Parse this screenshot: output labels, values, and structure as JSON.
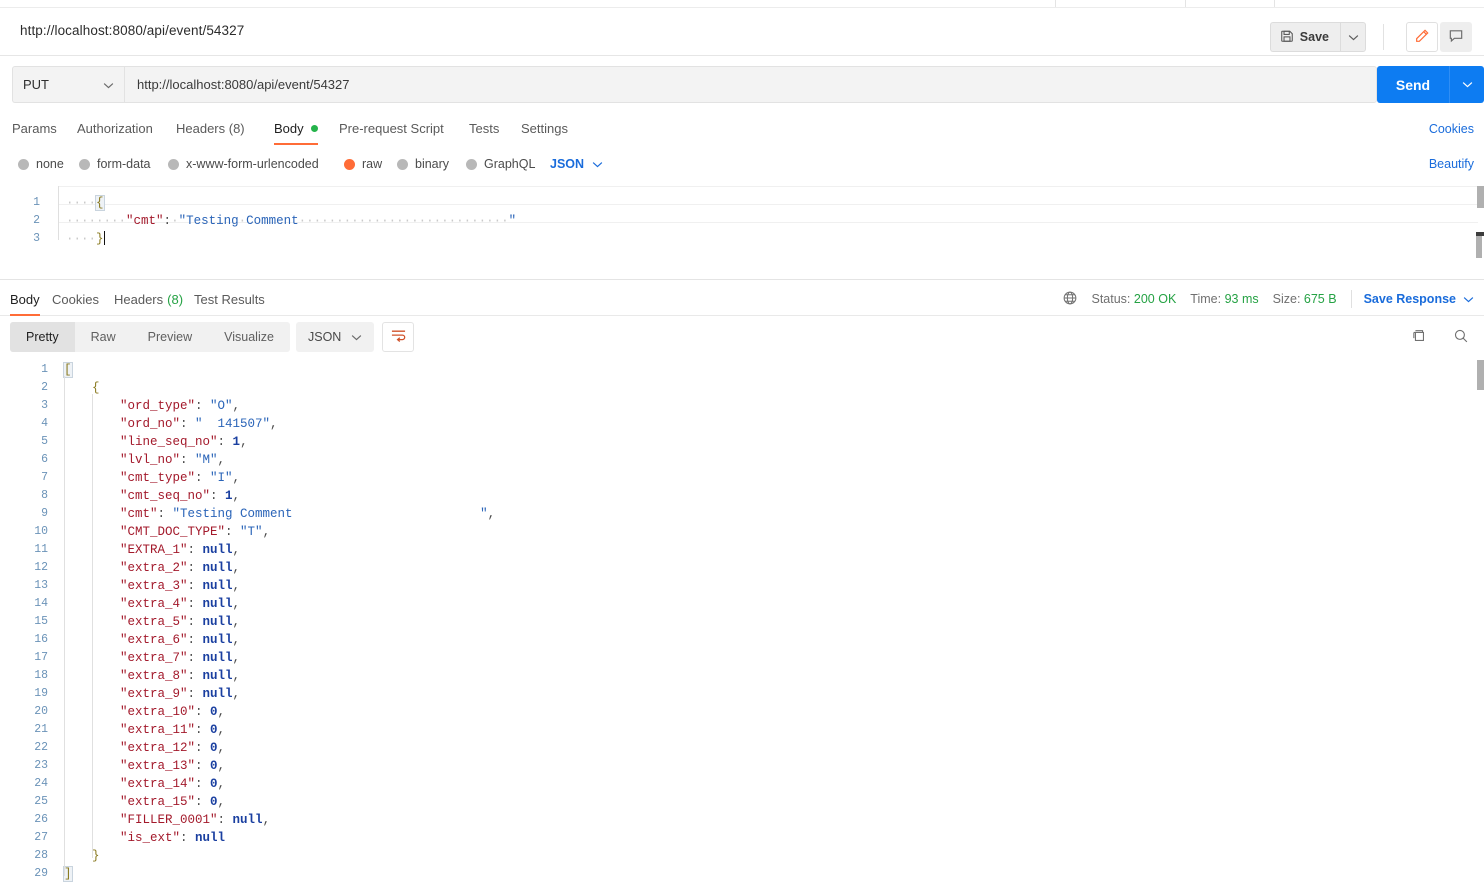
{
  "window": {
    "request_name": "http://localhost:8080/api/event/54327"
  },
  "toolbar": {
    "save_label": "Save",
    "save_icon": "floppy-disk-icon",
    "save_caret_icon": "chevron-down-icon",
    "edit_icon": "pencil-icon",
    "comment_icon": "comment-icon"
  },
  "url_bar": {
    "method": "PUT",
    "method_caret_icon": "chevron-down-icon",
    "url": "http://localhost:8080/api/event/54327",
    "send_label": "Send",
    "send_caret_icon": "chevron-down-icon"
  },
  "request_tabs": {
    "items": [
      {
        "label": "Params",
        "active": false
      },
      {
        "label": "Authorization",
        "active": false
      },
      {
        "label": "Headers (8)",
        "active": false
      },
      {
        "label": "Body",
        "active": true,
        "dot": true
      },
      {
        "label": "Pre-request Script",
        "active": false
      },
      {
        "label": "Tests",
        "active": false
      },
      {
        "label": "Settings",
        "active": false
      }
    ],
    "cookies_link": "Cookies"
  },
  "body_types": {
    "options": [
      {
        "label": "none",
        "selected": false
      },
      {
        "label": "form-data",
        "selected": false
      },
      {
        "label": "x-www-form-urlencoded",
        "selected": false
      },
      {
        "label": "raw",
        "selected": true
      },
      {
        "label": "binary",
        "selected": false
      },
      {
        "label": "GraphQL",
        "selected": false
      }
    ],
    "format": "JSON",
    "format_caret_icon": "chevron-down-icon",
    "beautify_link": "Beautify"
  },
  "request_body": {
    "line_numbers": [
      "1",
      "2",
      "3"
    ],
    "lines": [
      {
        "n": 1,
        "indent_dots": 4,
        "text": "{"
      },
      {
        "n": 2,
        "indent_dots": 4,
        "text": "    \"cmt\": \"Testing Comment",
        "pad_dots": 28,
        "tail": "\""
      },
      {
        "n": 3,
        "indent_dots": 4,
        "text": "}"
      }
    ],
    "raw": "{\n    \"cmt\": \"Testing Comment                            \"\n}"
  },
  "response_tabs": {
    "items": [
      {
        "label": "Body",
        "active": true
      },
      {
        "label": "Cookies",
        "active": false
      },
      {
        "label": "Headers",
        "count": "(8)",
        "active": false
      },
      {
        "label": "Test Results",
        "active": false
      }
    ]
  },
  "response_status": {
    "globe_icon": "globe-icon",
    "status_label": "Status:",
    "status_value": "200 OK",
    "time_label": "Time:",
    "time_value": "93 ms",
    "size_label": "Size:",
    "size_value": "675 B",
    "save_response_label": "Save Response",
    "save_response_caret_icon": "chevron-down-icon"
  },
  "response_view": {
    "modes": [
      {
        "label": "Pretty",
        "active": true
      },
      {
        "label": "Raw",
        "active": false
      },
      {
        "label": "Preview",
        "active": false
      },
      {
        "label": "Visualize",
        "active": false
      }
    ],
    "format": "JSON",
    "format_caret_icon": "chevron-down-icon",
    "wrap_icon": "word-wrap-icon",
    "copy_icon": "copy-icon",
    "search_icon": "search-icon"
  },
  "response_body": {
    "line_count": 29,
    "lines": [
      {
        "n": 1,
        "indent": 0,
        "kind": "bracket",
        "text": "["
      },
      {
        "n": 2,
        "indent": 1,
        "kind": "brace",
        "text": "{"
      },
      {
        "n": 3,
        "indent": 2,
        "kind": "pair",
        "key": "ord_type",
        "value": "O",
        "vtype": "string",
        "comma": true
      },
      {
        "n": 4,
        "indent": 2,
        "kind": "pair",
        "key": "ord_no",
        "value": "  141507",
        "vtype": "string",
        "comma": true
      },
      {
        "n": 5,
        "indent": 2,
        "kind": "pair",
        "key": "line_seq_no",
        "value": "1",
        "vtype": "number",
        "comma": true
      },
      {
        "n": 6,
        "indent": 2,
        "kind": "pair",
        "key": "lvl_no",
        "value": "M",
        "vtype": "string",
        "comma": true
      },
      {
        "n": 7,
        "indent": 2,
        "kind": "pair",
        "key": "cmt_type",
        "value": "I",
        "vtype": "string",
        "comma": true
      },
      {
        "n": 8,
        "indent": 2,
        "kind": "pair",
        "key": "cmt_seq_no",
        "value": "1",
        "vtype": "number",
        "comma": true
      },
      {
        "n": 9,
        "indent": 2,
        "kind": "pair",
        "key": "cmt",
        "value": "Testing Comment                         ",
        "vtype": "string",
        "comma": true
      },
      {
        "n": 10,
        "indent": 2,
        "kind": "pair",
        "key": "CMT_DOC_TYPE",
        "value": "T",
        "vtype": "string",
        "comma": true
      },
      {
        "n": 11,
        "indent": 2,
        "kind": "pair",
        "key": "EXTRA_1",
        "value": "null",
        "vtype": "null",
        "comma": true
      },
      {
        "n": 12,
        "indent": 2,
        "kind": "pair",
        "key": "extra_2",
        "value": "null",
        "vtype": "null",
        "comma": true
      },
      {
        "n": 13,
        "indent": 2,
        "kind": "pair",
        "key": "extra_3",
        "value": "null",
        "vtype": "null",
        "comma": true
      },
      {
        "n": 14,
        "indent": 2,
        "kind": "pair",
        "key": "extra_4",
        "value": "null",
        "vtype": "null",
        "comma": true
      },
      {
        "n": 15,
        "indent": 2,
        "kind": "pair",
        "key": "extra_5",
        "value": "null",
        "vtype": "null",
        "comma": true
      },
      {
        "n": 16,
        "indent": 2,
        "kind": "pair",
        "key": "extra_6",
        "value": "null",
        "vtype": "null",
        "comma": true
      },
      {
        "n": 17,
        "indent": 2,
        "kind": "pair",
        "key": "extra_7",
        "value": "null",
        "vtype": "null",
        "comma": true
      },
      {
        "n": 18,
        "indent": 2,
        "kind": "pair",
        "key": "extra_8",
        "value": "null",
        "vtype": "null",
        "comma": true
      },
      {
        "n": 19,
        "indent": 2,
        "kind": "pair",
        "key": "extra_9",
        "value": "null",
        "vtype": "null",
        "comma": true
      },
      {
        "n": 20,
        "indent": 2,
        "kind": "pair",
        "key": "extra_10",
        "value": "0",
        "vtype": "number",
        "comma": true
      },
      {
        "n": 21,
        "indent": 2,
        "kind": "pair",
        "key": "extra_11",
        "value": "0",
        "vtype": "number",
        "comma": true
      },
      {
        "n": 22,
        "indent": 2,
        "kind": "pair",
        "key": "extra_12",
        "value": "0",
        "vtype": "number",
        "comma": true
      },
      {
        "n": 23,
        "indent": 2,
        "kind": "pair",
        "key": "extra_13",
        "value": "0",
        "vtype": "number",
        "comma": true
      },
      {
        "n": 24,
        "indent": 2,
        "kind": "pair",
        "key": "extra_14",
        "value": "0",
        "vtype": "number",
        "comma": true
      },
      {
        "n": 25,
        "indent": 2,
        "kind": "pair",
        "key": "extra_15",
        "value": "0",
        "vtype": "number",
        "comma": true
      },
      {
        "n": 26,
        "indent": 2,
        "kind": "pair",
        "key": "FILLER_0001",
        "value": "null",
        "vtype": "null",
        "comma": true
      },
      {
        "n": 27,
        "indent": 2,
        "kind": "pair",
        "key": "is_ext",
        "value": "null",
        "vtype": "null",
        "comma": false
      },
      {
        "n": 28,
        "indent": 1,
        "kind": "brace",
        "text": "}"
      },
      {
        "n": 29,
        "indent": 0,
        "kind": "bracket",
        "text": "]"
      }
    ]
  },
  "colors": {
    "accent_orange": "#ff6c37",
    "link_blue": "#1a6cdb",
    "send_blue": "#0d7cf2",
    "status_green": "#25a244",
    "json_key": "#a3192b",
    "json_string": "#2a64b8",
    "json_number": "#1a3fa0"
  }
}
